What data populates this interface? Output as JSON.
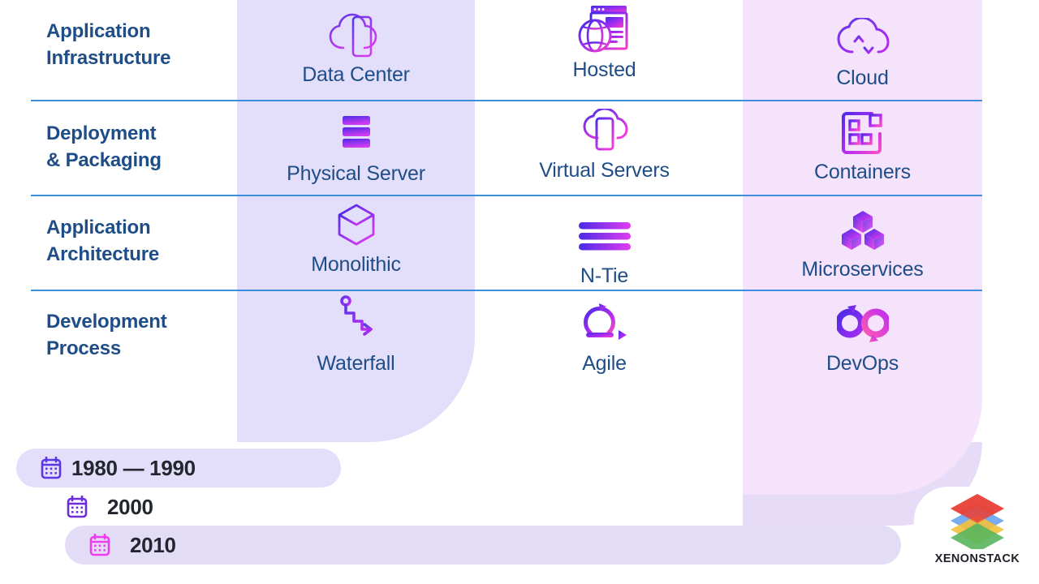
{
  "meta": {
    "kind": "infographic",
    "accent_purple": "#6b2de0",
    "accent_magenta": "#e83ce8",
    "label_navy": "#1e4d87",
    "separator_blue": "#3d8edb",
    "column_bg_1": "#e3dffa",
    "column_bg_2": "#ffffff",
    "column_bg_3": "#f5e2fb",
    "pill_bg": "#e3dcf7",
    "timeline_text": "#23262f"
  },
  "rows": [
    {
      "label": "Application\nInfrastructure",
      "label_line1": "Application",
      "label_line2": "Infrastructure",
      "cells": [
        {
          "label": "Data Center",
          "icon": "cloud-server-icon"
        },
        {
          "label": "Hosted",
          "icon": "globe-browser-icon"
        },
        {
          "label": "Cloud",
          "icon": "cloud-transfer-icon"
        }
      ]
    },
    {
      "label": "Deployment\n& Packaging",
      "label_line1": "Deployment",
      "label_line2": "& Packaging",
      "cells": [
        {
          "label": "Physical Server",
          "icon": "server-rack-icon"
        },
        {
          "label": "Virtual Servers",
          "icon": "cloud-vm-icon"
        },
        {
          "label": "Containers",
          "icon": "containers-grid-icon"
        }
      ]
    },
    {
      "label": "Application\nArchitecture",
      "label_line1": "Application",
      "label_line2": "Architecture",
      "cells": [
        {
          "label": "Monolithic",
          "icon": "cube-outline-icon"
        },
        {
          "label": "N-Tie",
          "icon": "stacked-bars-icon"
        },
        {
          "label": "Microservices",
          "icon": "three-cubes-icon"
        }
      ]
    },
    {
      "label": "Development\nProcess",
      "label_line1": "Development",
      "label_line2": "Process",
      "cells": [
        {
          "label": "Waterfall",
          "icon": "waterfall-steps-icon"
        },
        {
          "label": "Agile",
          "icon": "agile-cycle-icon"
        },
        {
          "label": "DevOps",
          "icon": "devops-infinity-icon"
        }
      ]
    }
  ],
  "timeline": [
    {
      "text": "1980 — 1990",
      "icon": "calendar-icon",
      "icon_color": "#5b36e8"
    },
    {
      "text": "2000",
      "icon": "calendar-icon",
      "icon_color": "#6b2de0"
    },
    {
      "text": "2010",
      "icon": "calendar-icon",
      "icon_color": "#ee3cee"
    }
  ],
  "logo": {
    "text": "XENONSTACK",
    "mark": "stacked-layers-logo",
    "layer_colors": [
      "#e8453c",
      "#5b9bf0",
      "#f3bb2b",
      "#4caf50"
    ]
  }
}
